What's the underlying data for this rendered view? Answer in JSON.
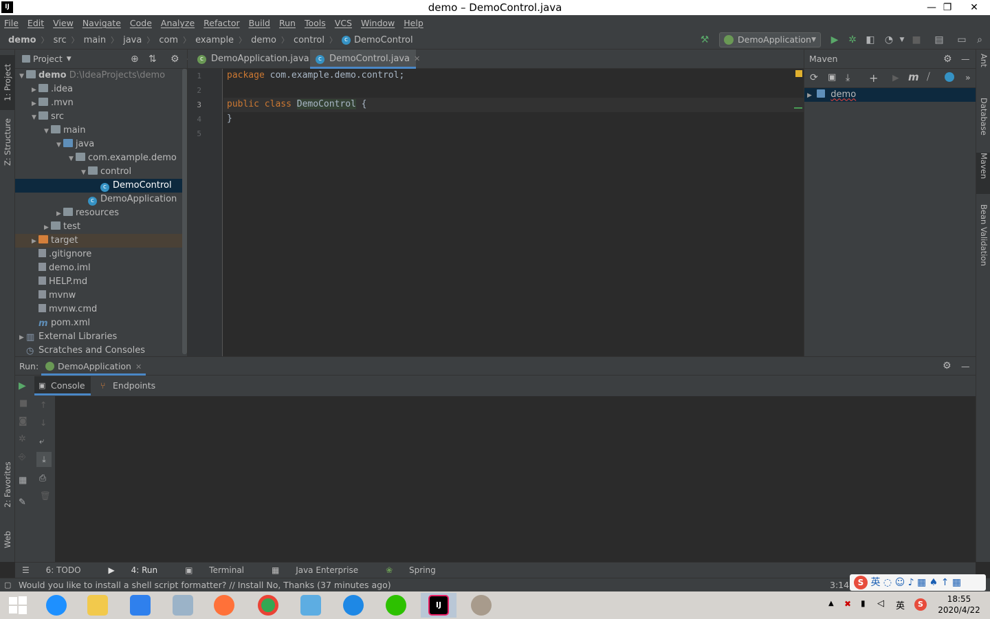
{
  "window": {
    "title": "demo – DemoControl.java",
    "minimize": "—",
    "maximize": "❐",
    "close": "✕"
  },
  "menu": [
    "File",
    "Edit",
    "View",
    "Navigate",
    "Code",
    "Analyze",
    "Refactor",
    "Build",
    "Run",
    "Tools",
    "VCS",
    "Window",
    "Help"
  ],
  "breadcrumb": [
    "demo",
    "src",
    "main",
    "java",
    "com",
    "example",
    "demo",
    "control",
    "DemoControl"
  ],
  "run_config": "DemoApplication",
  "left_strip": {
    "project": "1: Project",
    "structure": "Z: Structure",
    "favorites": "2: Favorites",
    "web": "Web"
  },
  "right_strip": {
    "ant": "Ant",
    "database": "Database",
    "maven": "Maven",
    "bean": "Bean Validation"
  },
  "project": {
    "header": "Project",
    "tree": [
      {
        "label": "demo",
        "suffix": "D:\\IdeaProjects\\demo",
        "indent": 0,
        "arrow": "▼",
        "icon": "folder",
        "bold": true
      },
      {
        "label": ".idea",
        "indent": 1,
        "arrow": "▶",
        "icon": "folder"
      },
      {
        "label": ".mvn",
        "indent": 1,
        "arrow": "▶",
        "icon": "folder"
      },
      {
        "label": "src",
        "indent": 1,
        "arrow": "▼",
        "icon": "folder"
      },
      {
        "label": "main",
        "indent": 2,
        "arrow": "▼",
        "icon": "folder"
      },
      {
        "label": "java",
        "indent": 3,
        "arrow": "▼",
        "icon": "folder-blue"
      },
      {
        "label": "com.example.demo",
        "indent": 4,
        "arrow": "▼",
        "icon": "package"
      },
      {
        "label": "control",
        "indent": 5,
        "arrow": "▼",
        "icon": "package"
      },
      {
        "label": "DemoControl",
        "indent": 6,
        "arrow": "",
        "icon": "class",
        "selected": true
      },
      {
        "label": "DemoApplication",
        "indent": 5,
        "arrow": "",
        "icon": "spring-class"
      },
      {
        "label": "resources",
        "indent": 3,
        "arrow": "▶",
        "icon": "folder"
      },
      {
        "label": "test",
        "indent": 2,
        "arrow": "▶",
        "icon": "folder"
      },
      {
        "label": "target",
        "indent": 1,
        "arrow": "▶",
        "icon": "folder-orange",
        "highlight": true
      },
      {
        "label": ".gitignore",
        "indent": 1,
        "arrow": "",
        "icon": "file"
      },
      {
        "label": "demo.iml",
        "indent": 1,
        "arrow": "",
        "icon": "file"
      },
      {
        "label": "HELP.md",
        "indent": 1,
        "arrow": "",
        "icon": "md"
      },
      {
        "label": "mvnw",
        "indent": 1,
        "arrow": "",
        "icon": "file"
      },
      {
        "label": "mvnw.cmd",
        "indent": 1,
        "arrow": "",
        "icon": "file"
      },
      {
        "label": "pom.xml",
        "indent": 1,
        "arrow": "",
        "icon": "maven"
      },
      {
        "label": "External Libraries",
        "indent": 0,
        "arrow": "▶",
        "icon": "lib"
      },
      {
        "label": "Scratches and Consoles",
        "indent": 0,
        "arrow": "",
        "icon": "scratch"
      }
    ]
  },
  "editor": {
    "tabs": [
      {
        "label": "DemoApplication.java",
        "active": false
      },
      {
        "label": "DemoControl.java",
        "active": true
      }
    ],
    "line_numbers": [
      "1",
      "2",
      "3",
      "4",
      "5"
    ],
    "code": {
      "l1_kw": "package",
      "l1_rest": " com.example.demo.control;",
      "l3_kw": "public class",
      "l3_cls": "DemoControl",
      "l3_rest": " {",
      "l4": "}"
    }
  },
  "maven": {
    "header": "Maven",
    "root": "demo"
  },
  "run": {
    "label": "Run:",
    "tab": "DemoApplication",
    "subtabs": [
      "Console",
      "Endpoints"
    ]
  },
  "toolwindows": [
    {
      "label": "6: TODO",
      "icon": "☰"
    },
    {
      "label": "4: Run",
      "icon": "▶"
    },
    {
      "label": "Terminal",
      "icon": "▣"
    },
    {
      "label": "Java Enterprise",
      "icon": "▦"
    },
    {
      "label": "Spring",
      "icon": "❀"
    }
  ],
  "status": {
    "message": "Would you like to install a shell script formatter? // Install    No, Thanks (37 minutes ago)",
    "position": "3:14"
  },
  "taskbar": {
    "time": "18:55",
    "date": "2020/4/22",
    "ime": "英",
    "apps": [
      "start",
      "ie",
      "explorer",
      "baidu-netdisk",
      "monitor",
      "firefox",
      "chrome",
      "notes",
      "qq-browser",
      "wechat",
      "intellij",
      "photo"
    ]
  }
}
